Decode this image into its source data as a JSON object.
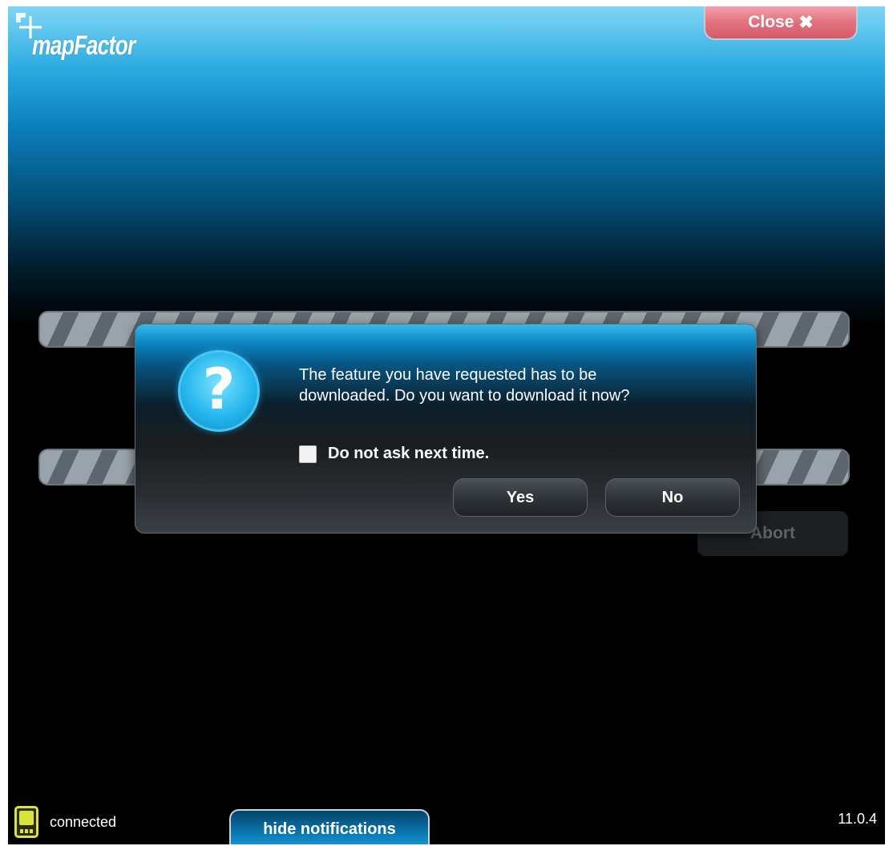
{
  "app": {
    "logo_text": "mapFactor",
    "close_label": "Close",
    "close_icon": "close-x-icon"
  },
  "background": {
    "abort_label": "Abort"
  },
  "dialog": {
    "icon": "question-icon",
    "icon_glyph": "?",
    "message_line1": "The feature you have requested has to be",
    "message_line2": "downloaded. Do you want to download it now?",
    "checkbox_label": "Do not ask next time.",
    "checkbox_checked": false,
    "yes_label": "Yes",
    "no_label": "No"
  },
  "status_bar": {
    "connection_icon": "device-icon",
    "connection_status": "connected",
    "notifications_button": "hide notifications",
    "version": "11.0.4"
  },
  "colors": {
    "accent_blue": "#0e88c4",
    "close_red": "#e2727f",
    "device_yellow": "#d9e33a"
  }
}
